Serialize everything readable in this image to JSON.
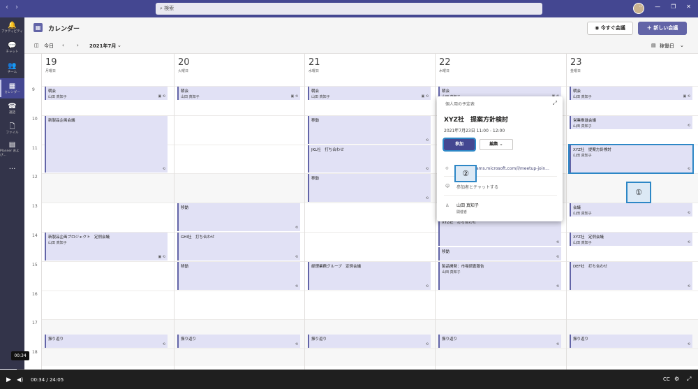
{
  "search": {
    "placeholder": "検索"
  },
  "rail": [
    {
      "label": "アクティビティ",
      "icon": "bell-icon",
      "glyph": "🔔"
    },
    {
      "label": "チャット",
      "icon": "chat-icon",
      "glyph": "💬"
    },
    {
      "label": "チーム",
      "icon": "teams-icon",
      "glyph": "👥"
    },
    {
      "label": "カレンダー",
      "icon": "calendar-icon",
      "glyph": "▦",
      "active": true
    },
    {
      "label": "通話",
      "icon": "phone-icon",
      "glyph": "☎"
    },
    {
      "label": "ファイル",
      "icon": "file-icon",
      "glyph": "🗋"
    },
    {
      "label": "Planner および...",
      "icon": "planner-icon",
      "glyph": "▤"
    },
    {
      "label": "",
      "icon": "more-icon",
      "glyph": "···"
    }
  ],
  "header": {
    "title": "カレンダー",
    "meet_now": "今すぐ会議",
    "new_meeting": "新しい会議"
  },
  "toolbar": {
    "today": "今日",
    "month": "2021年7月",
    "view": "稼働日"
  },
  "days": [
    {
      "num": "19",
      "weekday": "月曜日"
    },
    {
      "num": "20",
      "weekday": "火曜日"
    },
    {
      "num": "21",
      "weekday": "水曜日"
    },
    {
      "num": "22",
      "weekday": "木曜日"
    },
    {
      "num": "23",
      "weekday": "金曜日"
    }
  ],
  "hours": [
    "9",
    "10",
    "11",
    "12",
    "13",
    "14",
    "15",
    "16",
    "17",
    "18"
  ],
  "events": [
    {
      "day": 0,
      "start": 9.0,
      "end": 9.5,
      "title": "朝会",
      "owner": "山田 真知子",
      "icons": "▣ ⟲"
    },
    {
      "day": 0,
      "start": 10.0,
      "end": 12.0,
      "title": "新製品企画会議",
      "owner": "",
      "icons": "⟲"
    },
    {
      "day": 0,
      "start": 14.0,
      "end": 15.0,
      "title": "新製品企画プロジェクト　定例会議",
      "owner": "山田 真知子",
      "icons": "▣ ⟲"
    },
    {
      "day": 0,
      "start": 17.5,
      "end": 18.0,
      "title": "振り返り",
      "owner": "",
      "icons": "⟲"
    },
    {
      "day": 1,
      "start": 9.0,
      "end": 9.5,
      "title": "朝会",
      "owner": "山田 真知子",
      "icons": "▣ ⟲"
    },
    {
      "day": 1,
      "start": 13.0,
      "end": 14.0,
      "title": "移動",
      "owner": "",
      "icons": "⟲"
    },
    {
      "day": 1,
      "start": 14.0,
      "end": 15.0,
      "title": "GHI社　打ち合わせ",
      "owner": "",
      "icons": "⟲"
    },
    {
      "day": 1,
      "start": 15.0,
      "end": 16.0,
      "title": "移動",
      "owner": "",
      "icons": "⟲"
    },
    {
      "day": 1,
      "start": 17.5,
      "end": 18.0,
      "title": "振り返り",
      "owner": "",
      "icons": "⟲"
    },
    {
      "day": 2,
      "start": 9.0,
      "end": 9.5,
      "title": "朝会",
      "owner": "山田 真知子",
      "icons": "▣ ⟲"
    },
    {
      "day": 2,
      "start": 10.0,
      "end": 11.0,
      "title": "移動",
      "owner": "",
      "icons": "⟲"
    },
    {
      "day": 2,
      "start": 11.0,
      "end": 12.0,
      "title": "JKL社　打ち合わせ",
      "owner": "",
      "icons": "⟲"
    },
    {
      "day": 2,
      "start": 12.0,
      "end": 13.0,
      "title": "移動",
      "owner": "",
      "icons": "⟲"
    },
    {
      "day": 2,
      "start": 15.0,
      "end": 16.0,
      "title": "経理業務グループ　定例会議",
      "owner": "",
      "icons": "⟲"
    },
    {
      "day": 2,
      "start": 17.5,
      "end": 18.0,
      "title": "振り返り",
      "owner": "",
      "icons": "⟲"
    },
    {
      "day": 3,
      "start": 9.0,
      "end": 9.5,
      "title": "朝会",
      "owner": "山田 真知子",
      "icons": "▣ ⟲"
    },
    {
      "day": 3,
      "start": 13.5,
      "end": 14.5,
      "title": "XYZ社　打ち合わせ",
      "owner": "",
      "icons": "⟲"
    },
    {
      "day": 3,
      "start": 14.5,
      "end": 15.0,
      "title": "移動",
      "owner": "",
      "icons": "⟲"
    },
    {
      "day": 3,
      "start": 15.0,
      "end": 16.0,
      "title": "製品開発：市場調査報告",
      "owner": "山田 真知子",
      "icons": "⟲"
    },
    {
      "day": 3,
      "start": 17.5,
      "end": 18.0,
      "title": "振り返り",
      "owner": "",
      "icons": "⟲"
    },
    {
      "day": 4,
      "start": 9.0,
      "end": 9.5,
      "title": "朝会",
      "owner": "山田 真知子",
      "icons": "▣ ⟲"
    },
    {
      "day": 4,
      "start": 10.0,
      "end": 10.5,
      "title": "営業推進会議",
      "owner": "山田 真知子",
      "icons": "⟲"
    },
    {
      "day": 4,
      "start": 11.0,
      "end": 12.0,
      "title": "XYZ社　提案方針検討",
      "owner": "山田 真知子",
      "icons": "⟲",
      "selected": true
    },
    {
      "day": 4,
      "start": 13.0,
      "end": 13.5,
      "title": "会議",
      "owner": "山田 真知子",
      "icons": "⟲"
    },
    {
      "day": 4,
      "start": 14.0,
      "end": 14.5,
      "title": "XYZ社　定例会議",
      "owner": "山田 真知子",
      "icons": "⟲"
    },
    {
      "day": 4,
      "start": 15.0,
      "end": 16.0,
      "title": "DEF社　打ち合わせ",
      "owner": "",
      "icons": "⟲"
    },
    {
      "day": 4,
      "start": 17.5,
      "end": 18.0,
      "title": "振り返り",
      "owner": "",
      "icons": "⟲"
    }
  ],
  "popup": {
    "calendar": "個人用の予定表",
    "title": "XYZ社　提案方針検討",
    "time": "2021年7月23日 11:00 - 12:00",
    "join": "参加",
    "edit": "編集",
    "link": "ams.microsoft.com/l/meetup-join...",
    "chat": "参加者とチャットする",
    "organizer_name": "山田 真知子",
    "organizer_role": "開催者"
  },
  "callouts": {
    "one": "①",
    "two": "②"
  },
  "video": {
    "time": "00:34 / 24:05",
    "bubble": "00:34",
    "progress": 0.024
  }
}
